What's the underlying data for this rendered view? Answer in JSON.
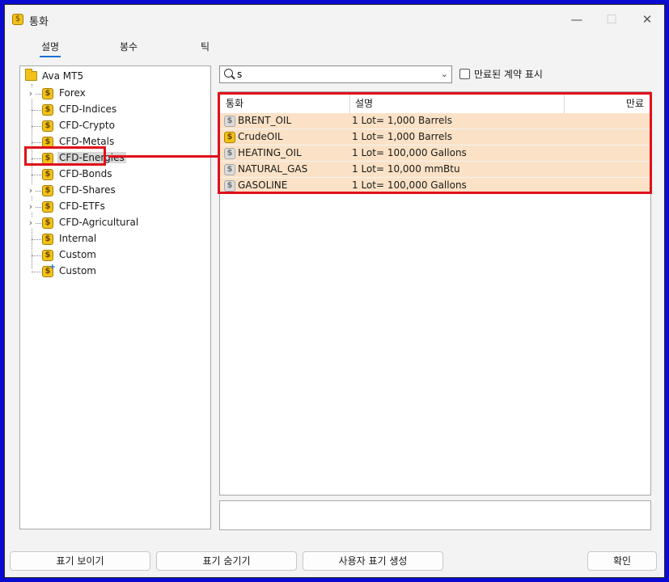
{
  "window": {
    "title": "통화"
  },
  "tabs": [
    {
      "label": "설명"
    },
    {
      "label": "봉수"
    },
    {
      "label": "틱"
    }
  ],
  "tree": {
    "root": "Ava MT5",
    "items": [
      {
        "label": "Forex",
        "expandable": true
      },
      {
        "label": "CFD-Indices",
        "expandable": false
      },
      {
        "label": "CFD-Crypto",
        "expandable": false
      },
      {
        "label": "CFD-Metals",
        "expandable": false
      },
      {
        "label": "CFD-Energies",
        "expandable": false,
        "selected": true
      },
      {
        "label": "CFD-Bonds",
        "expandable": false
      },
      {
        "label": "CFD-Shares",
        "expandable": true
      },
      {
        "label": "CFD-ETFs",
        "expandable": true
      },
      {
        "label": "CFD-Agricultural",
        "expandable": true
      },
      {
        "label": "Internal",
        "expandable": false
      },
      {
        "label": "Custom",
        "expandable": false
      },
      {
        "label": "Custom",
        "expandable": false,
        "icon": "coin-plus-icon"
      }
    ]
  },
  "search": {
    "value": "s"
  },
  "checkbox": {
    "label": "만료된 계약 표시",
    "checked": false
  },
  "table": {
    "headers": {
      "symbol": "통화",
      "description": "설명",
      "expiry": "만료"
    },
    "rows": [
      {
        "symbol": "BRENT_OIL",
        "description": "1 Lot= 1,000 Barrels",
        "expiry": "",
        "icon": "gray"
      },
      {
        "symbol": "CrudeOIL",
        "description": "1 Lot= 1,000 Barrels",
        "expiry": "",
        "icon": "gold"
      },
      {
        "symbol": "HEATING_OIL",
        "description": "1 Lot= 100,000 Gallons",
        "expiry": "",
        "icon": "gray"
      },
      {
        "symbol": "NATURAL_GAS",
        "description": "1 Lot= 10,000 mmBtu",
        "expiry": "",
        "icon": "gray"
      },
      {
        "symbol": "GASOLINE",
        "description": "1 Lot= 100,000 Gallons",
        "expiry": "",
        "icon": "gray"
      }
    ]
  },
  "buttons": {
    "show": "표기 보이기",
    "hide": "표기 숨기기",
    "create": "사용자 표기 생성",
    "ok": "확인"
  },
  "colors": {
    "selected_row": "#fbe2c6",
    "highlight": "#e0101a",
    "coin": "#f2c21a",
    "border": "#0a0ad0"
  }
}
